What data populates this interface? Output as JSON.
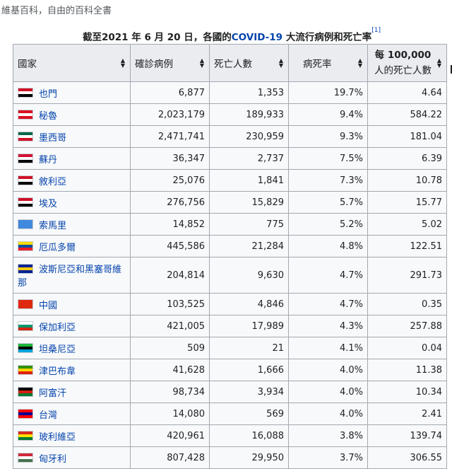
{
  "site_subtitle": "維基百科，自由的百科全書",
  "caption": {
    "prefix": "截至2021 年 6 月 20 日，各國的",
    "link": "COVID-19",
    "suffix": " 大流行病例和死亡率",
    "ref": "[1]"
  },
  "headers": [
    "國家",
    "確診病例",
    "死亡人數",
    "病死率",
    "每 100,000",
    "人的死亡人數"
  ],
  "colors": {
    "link": "#0645ad",
    "header_bg": "#eaecf0",
    "cell_bg": "#f8f9fa",
    "border": "#a2a9b1"
  },
  "rows": [
    {
      "country": "也門",
      "cases": "6,877",
      "deaths": "1,353",
      "cfr": "19.7%",
      "per100k": "4.64",
      "flag": [
        "#ce1126",
        "#ffffff",
        "#000000"
      ]
    },
    {
      "country": "秘魯",
      "cases": "2,023,179",
      "deaths": "189,933",
      "cfr": "9.4%",
      "per100k": "584.22",
      "flag": [
        "#d91023",
        "#ffffff",
        "#d91023"
      ]
    },
    {
      "country": "墨西哥",
      "cases": "2,471,741",
      "deaths": "230,959",
      "cfr": "9.3%",
      "per100k": "181.04",
      "flag": [
        "#006847",
        "#ffffff",
        "#ce1126"
      ]
    },
    {
      "country": "蘇丹",
      "cases": "36,347",
      "deaths": "2,737",
      "cfr": "7.5%",
      "per100k": "6.39",
      "flag": [
        "#d21034",
        "#ffffff",
        "#000000"
      ]
    },
    {
      "country": "敘利亞",
      "cases": "25,076",
      "deaths": "1,841",
      "cfr": "7.3%",
      "per100k": "10.78",
      "flag": [
        "#ce1126",
        "#ffffff",
        "#000000"
      ]
    },
    {
      "country": "埃及",
      "cases": "276,756",
      "deaths": "15,829",
      "cfr": "5.7%",
      "per100k": "15.77",
      "flag": [
        "#ce1126",
        "#ffffff",
        "#000000"
      ]
    },
    {
      "country": "索馬里",
      "cases": "14,852",
      "deaths": "775",
      "cfr": "5.2%",
      "per100k": "5.02",
      "flag": [
        "#4189dd",
        "#4189dd",
        "#4189dd"
      ]
    },
    {
      "country": "厄瓜多爾",
      "cases": "445,586",
      "deaths": "21,284",
      "cfr": "4.8%",
      "per100k": "122.51",
      "flag": [
        "#ffdd00",
        "#034ea2",
        "#ed1c24"
      ]
    },
    {
      "country": "波斯尼亞和黑塞哥維那",
      "cases": "204,814",
      "deaths": "9,630",
      "cfr": "4.7%",
      "per100k": "291.73",
      "flag": [
        "#002395",
        "#fecb00",
        "#002395"
      ],
      "tall": true
    },
    {
      "country": "中國",
      "cases": "103,525",
      "deaths": "4,846",
      "cfr": "4.7%",
      "per100k": "0.35",
      "flag": [
        "#de2910",
        "#de2910",
        "#de2910"
      ]
    },
    {
      "country": "保加利亞",
      "cases": "421,005",
      "deaths": "17,989",
      "cfr": "4.3%",
      "per100k": "257.88",
      "flag": [
        "#ffffff",
        "#00966e",
        "#d62612"
      ]
    },
    {
      "country": "坦桑尼亞",
      "cases": "509",
      "deaths": "21",
      "cfr": "4.1%",
      "per100k": "0.04",
      "flag": [
        "#1eb53a",
        "#000000",
        "#00a3dd"
      ]
    },
    {
      "country": "津巴布韋",
      "cases": "41,628",
      "deaths": "1,666",
      "cfr": "4.0%",
      "per100k": "11.38",
      "flag": [
        "#319208",
        "#ffd200",
        "#de2010"
      ]
    },
    {
      "country": "阿富汗",
      "cases": "98,734",
      "deaths": "3,934",
      "cfr": "4.0%",
      "per100k": "10.34",
      "flag": [
        "#000000",
        "#d32011",
        "#007a36"
      ]
    },
    {
      "country": "台灣",
      "cases": "14,080",
      "deaths": "569",
      "cfr": "4.0%",
      "per100k": "2.41",
      "flag": [
        "#fe0000",
        "#000095",
        "#fe0000"
      ]
    },
    {
      "country": "玻利維亞",
      "cases": "420,961",
      "deaths": "16,088",
      "cfr": "3.8%",
      "per100k": "139.74",
      "flag": [
        "#d52b1e",
        "#f9e300",
        "#007934"
      ]
    },
    {
      "country": "匈牙利",
      "cases": "807,428",
      "deaths": "29,950",
      "cfr": "3.7%",
      "per100k": "306.55",
      "flag": [
        "#ce2939",
        "#ffffff",
        "#477050"
      ]
    }
  ]
}
